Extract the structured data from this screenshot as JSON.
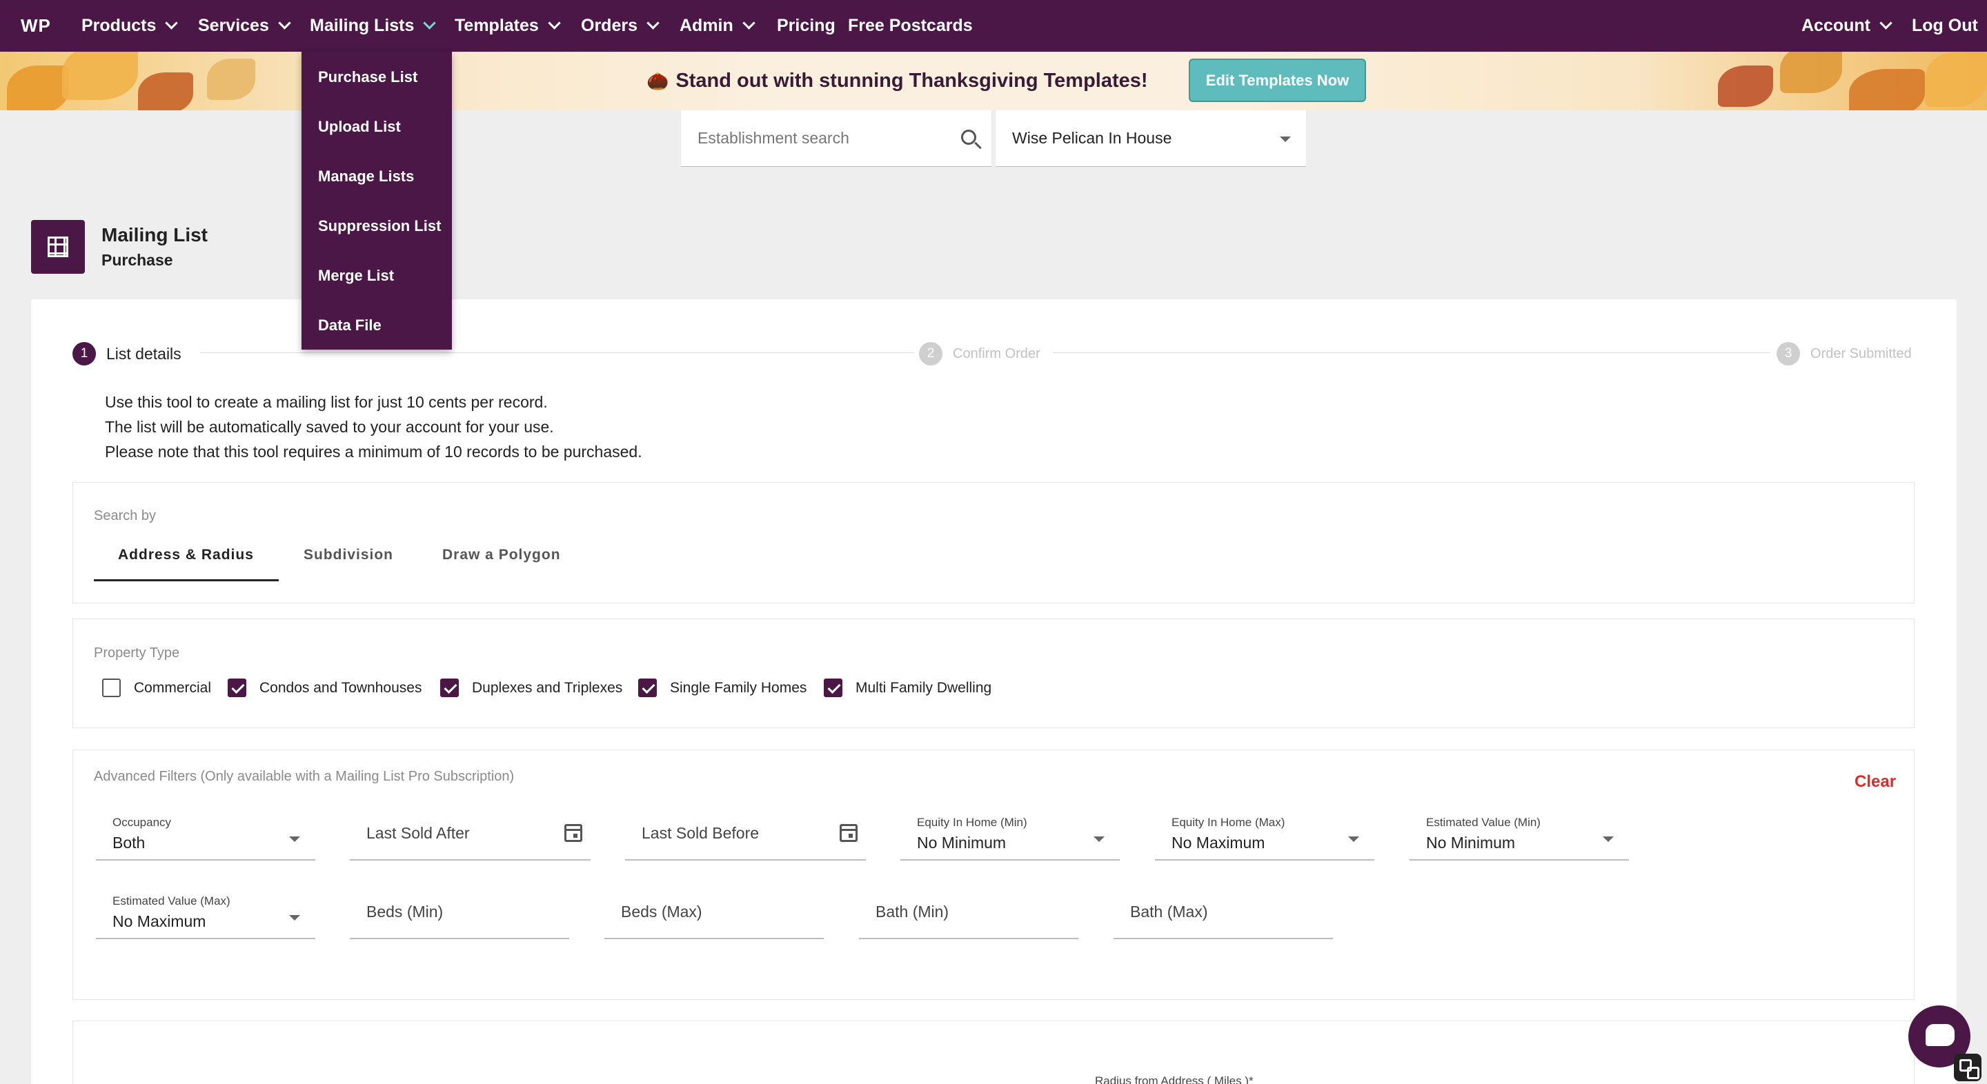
{
  "nav": {
    "logo": "WP",
    "items": [
      {
        "label": "Products"
      },
      {
        "label": "Services"
      },
      {
        "label": "Mailing Lists"
      },
      {
        "label": "Templates"
      },
      {
        "label": "Orders"
      },
      {
        "label": "Admin"
      },
      {
        "label": "Pricing"
      },
      {
        "label": "Free Postcards"
      }
    ],
    "account": "Account",
    "logout": "Log Out"
  },
  "dropdown": {
    "items": [
      "Purchase List",
      "Upload List",
      "Manage Lists",
      "Suppression List",
      "Merge List",
      "Data File"
    ]
  },
  "banner": {
    "text": "Stand out with stunning Thanksgiving Templates!",
    "button": "Edit Templates Now"
  },
  "search": {
    "placeholder": "Establishment search",
    "establishment": "Wise Pelican In House"
  },
  "page": {
    "title": "Mailing List",
    "subtitle": "Purchase"
  },
  "steps": [
    {
      "num": "1",
      "label": "List details",
      "active": true
    },
    {
      "num": "2",
      "label": "Confirm Order",
      "active": false
    },
    {
      "num": "3",
      "label": "Order Submitted",
      "active": false
    }
  ],
  "intro": [
    "Use this tool to create a mailing list for just 10 cents per record.",
    "The list will be automatically saved to your account for your use.",
    "Please note that this tool requires a minimum of 10 records to be purchased."
  ],
  "search_by": {
    "label": "Search by",
    "tabs": [
      "Address & Radius",
      "Subdivision",
      "Draw a Polygon"
    ]
  },
  "property_type": {
    "label": "Property Type",
    "options": [
      {
        "label": "Commercial",
        "checked": false
      },
      {
        "label": "Condos and Townhouses",
        "checked": true
      },
      {
        "label": "Duplexes and Triplexes",
        "checked": true
      },
      {
        "label": "Single Family Homes",
        "checked": true
      },
      {
        "label": "Multi Family Dwelling",
        "checked": true
      }
    ]
  },
  "advanced": {
    "label": "Advanced Filters (Only available with a Mailing List Pro Subscription)",
    "clear": "Clear",
    "occupancy": {
      "label": "Occupancy",
      "value": "Both"
    },
    "last_sold_after": "Last Sold After",
    "last_sold_before": "Last Sold Before",
    "equity_min": {
      "label": "Equity In Home (Min)",
      "value": "No Minimum"
    },
    "equity_max": {
      "label": "Equity In Home (Max)",
      "value": "No Maximum"
    },
    "est_min": {
      "label": "Estimated Value (Min)",
      "value": "No Minimum"
    },
    "est_max": {
      "label": "Estimated Value (Max)",
      "value": "No Maximum"
    },
    "beds_min": "Beds (Min)",
    "beds_max": "Beds (Max)",
    "bath_min": "Bath (Min)",
    "bath_max": "Bath (Max)"
  },
  "radius_label": "Radius from Address ( Miles )*",
  "colors": {
    "brand": "#4a1747",
    "accent": "#5fbcbc",
    "danger": "#d32f2f"
  }
}
